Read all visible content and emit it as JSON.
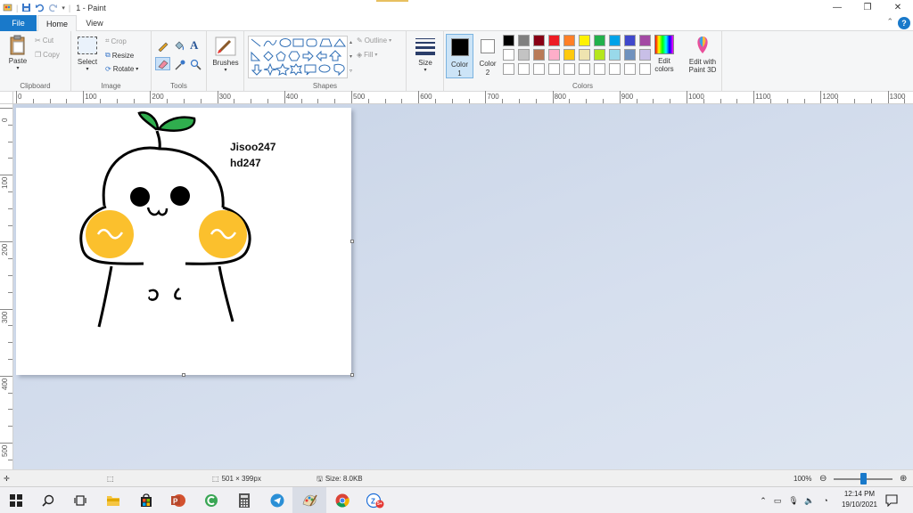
{
  "window": {
    "title": "1 - Paint",
    "minimize": "—",
    "restore": "❐",
    "close": "✕"
  },
  "tabs": {
    "file": "File",
    "home": "Home",
    "view": "View",
    "help": "?"
  },
  "clipboard": {
    "paste": "Paste",
    "cut": "Cut",
    "copy": "Copy",
    "group_label": "Clipboard"
  },
  "image": {
    "select": "Select",
    "crop": "Crop",
    "resize": "Resize",
    "rotate": "Rotate",
    "group_label": "Image"
  },
  "tools": {
    "group_label": "Tools"
  },
  "brushes": {
    "label": "Brushes"
  },
  "shapes": {
    "outline": "Outline",
    "fill": "Fill",
    "group_label": "Shapes"
  },
  "size": {
    "label": "Size"
  },
  "colors": {
    "color1_label": "Color",
    "color1_num": "1",
    "color2_label": "Color",
    "color2_num": "2",
    "edit_colors_line1": "Edit",
    "edit_colors_line2": "colors",
    "group_label": "Colors",
    "color1": "#000000",
    "color2": "#ffffff",
    "palette_row1": [
      "#000000",
      "#7f7f7f",
      "#880015",
      "#ed1c24",
      "#ff7f27",
      "#fff200",
      "#22b14c",
      "#00a2e8",
      "#3f48cc",
      "#a349a4"
    ],
    "palette_row2": [
      "#ffffff",
      "#c3c3c3",
      "#b97a57",
      "#ffaec9",
      "#ffc90e",
      "#efe4b0",
      "#b5e61d",
      "#99d9ea",
      "#7092be",
      "#c8bfe7"
    ]
  },
  "paint3d": {
    "line1": "Edit with",
    "line2": "Paint 3D"
  },
  "ruler": {
    "h_labels": [
      "0",
      "100",
      "200",
      "300",
      "400",
      "500",
      "600",
      "700",
      "800",
      "900",
      "1000",
      "1100",
      "1200",
      "1300"
    ],
    "v_labels": [
      "0",
      "100",
      "200",
      "300",
      "400",
      "500"
    ]
  },
  "canvas_text": {
    "line1": "Jisoo247",
    "line2": "hd247"
  },
  "statusbar": {
    "dimensions": "501 × 399px",
    "size": "Size: 8.0KB",
    "zoom": "100%",
    "zoom_level": 0.5
  },
  "taskbar": {
    "time": "12:14 PM",
    "date": "19/10/2021",
    "badge": "5+"
  }
}
